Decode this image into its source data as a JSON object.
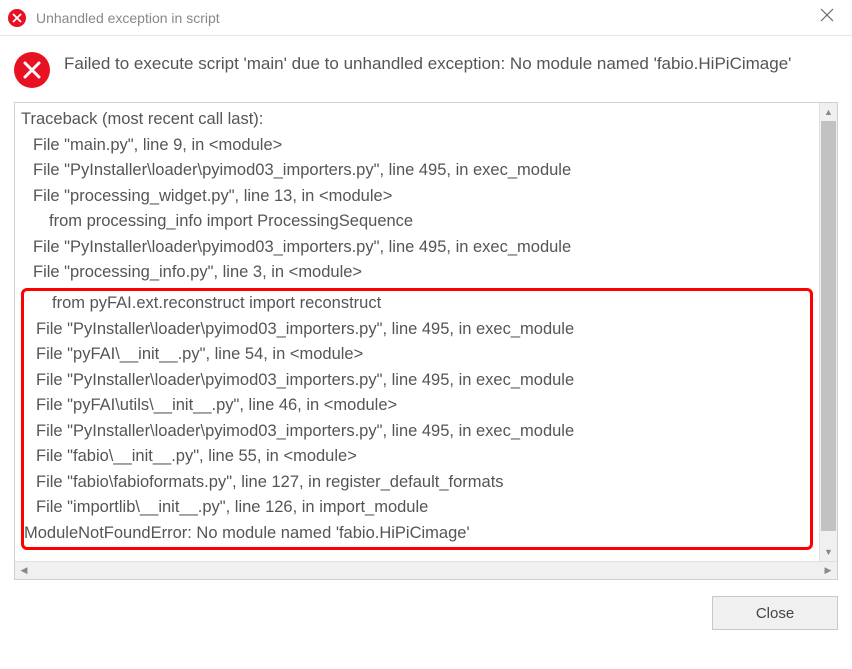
{
  "titlebar": {
    "title": "Unhandled exception in script"
  },
  "error": {
    "message": "Failed to execute script 'main' due to unhandled exception: No module named 'fabio.HiPiCimage'"
  },
  "traceback": {
    "header": "Traceback (most recent call last):",
    "lines_before_highlight": [
      {
        "indent": 1,
        "text": "File \"main.py\", line 9, in <module>"
      },
      {
        "indent": 1,
        "text": "File \"PyInstaller\\loader\\pyimod03_importers.py\", line 495, in exec_module"
      },
      {
        "indent": 1,
        "text": "File \"processing_widget.py\", line 13, in <module>"
      },
      {
        "indent": 2,
        "text": "from processing_info import ProcessingSequence"
      },
      {
        "indent": 1,
        "text": "File \"PyInstaller\\loader\\pyimod03_importers.py\", line 495, in exec_module"
      },
      {
        "indent": 1,
        "text": "File \"processing_info.py\", line 3, in <module>"
      }
    ],
    "highlighted_lines": [
      {
        "indent": 2,
        "text": "from pyFAI.ext.reconstruct import reconstruct"
      },
      {
        "indent": 1,
        "text": "File \"PyInstaller\\loader\\pyimod03_importers.py\", line 495, in exec_module"
      },
      {
        "indent": 1,
        "text": "File \"pyFAI\\__init__.py\", line 54, in <module>"
      },
      {
        "indent": 1,
        "text": "File \"PyInstaller\\loader\\pyimod03_importers.py\", line 495, in exec_module"
      },
      {
        "indent": 1,
        "text": "File \"pyFAI\\utils\\__init__.py\", line 46, in <module>"
      },
      {
        "indent": 1,
        "text": "File \"PyInstaller\\loader\\pyimod03_importers.py\", line 495, in exec_module"
      },
      {
        "indent": 1,
        "text": "File \"fabio\\__init__.py\", line 55, in <module>"
      },
      {
        "indent": 1,
        "text": "File \"fabio\\fabioformats.py\", line 127, in register_default_formats"
      },
      {
        "indent": 1,
        "text": "File \"importlib\\__init__.py\", line 126, in import_module"
      },
      {
        "indent": 0,
        "text": "ModuleNotFoundError: No module named 'fabio.HiPiCimage'"
      }
    ]
  },
  "buttons": {
    "close": "Close"
  }
}
